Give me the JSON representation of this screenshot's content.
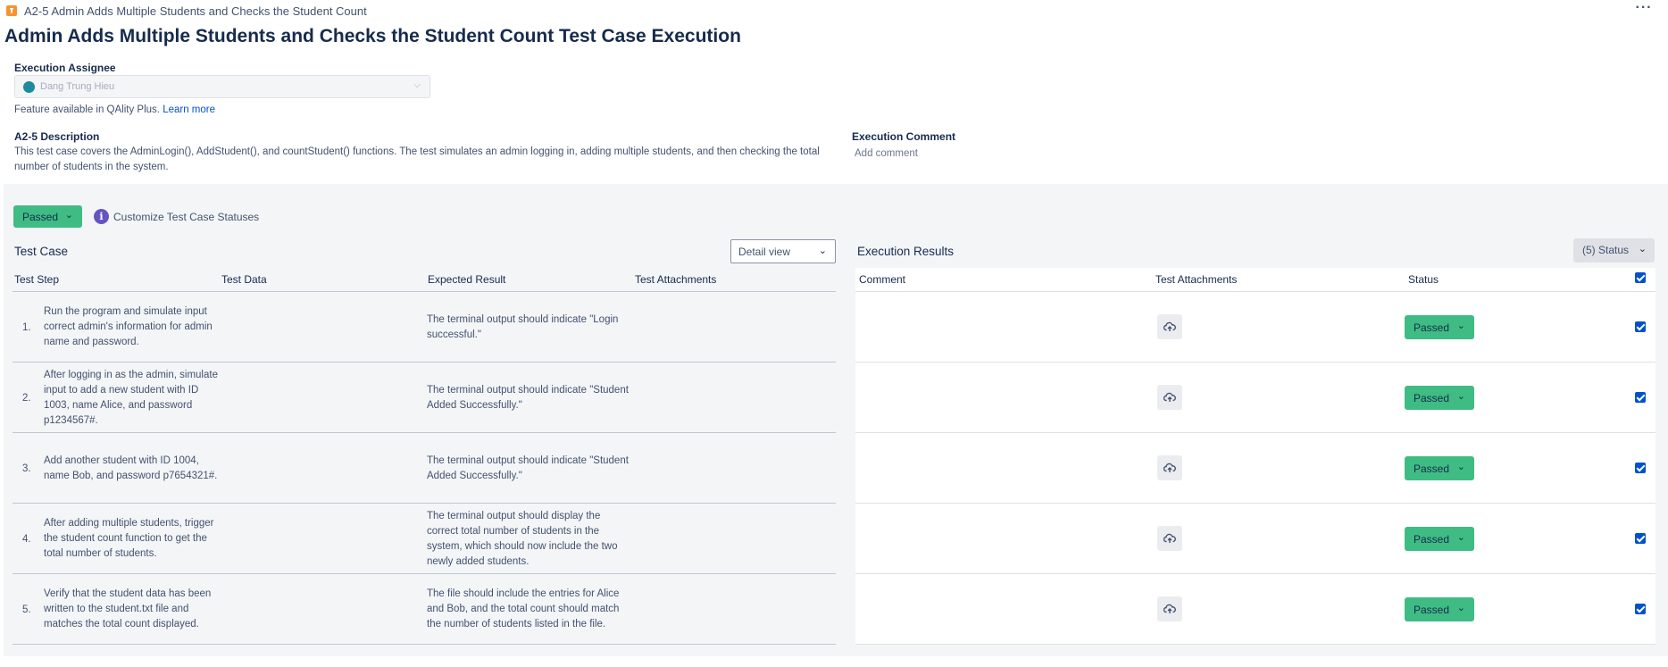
{
  "header": {
    "breadcrumb": "A2-5 Admin Adds Multiple Students and Checks the Student Count",
    "more_label": "···",
    "title": "Admin Adds Multiple Students and Checks the Student Count Test Case Execution"
  },
  "assignee": {
    "label": "Execution Assignee",
    "value": "Dang Trung Hieu",
    "feature_note": "Feature available in QAlity Plus.",
    "learn_more": "Learn more"
  },
  "description": {
    "label": "A2-5 Description",
    "text": "This test case covers the AdminLogin(), AddStudent(), and countStudent() functions. The test simulates an admin logging in, adding multiple students, and then checking the total number of students in the system."
  },
  "execution_comment": {
    "label": "Execution Comment",
    "placeholder": "Add comment"
  },
  "toolbar": {
    "overall_status": "Passed",
    "customize_label": "Customize Test Case Statuses",
    "info_glyph": "i"
  },
  "test_case": {
    "heading": "Test Case",
    "view_select": "Detail view",
    "columns": [
      "Test Step",
      "Test Data",
      "Expected Result",
      "Test Attachments"
    ],
    "rows": [
      {
        "num": "1.",
        "step": "Run the program and simulate input correct admin's information for admin name and password.",
        "data": "",
        "expected": "The terminal output should indicate \"Login successful.\""
      },
      {
        "num": "2.",
        "step": "After logging in as the admin, simulate input to add a new student with ID 1003, name Alice, and password p1234567#.",
        "data": "",
        "expected": "The terminal output should indicate \"Student Added Successfully.\""
      },
      {
        "num": "3.",
        "step": "Add another student with ID 1004, name Bob, and password p7654321#.",
        "data": "",
        "expected": "The terminal output should indicate \"Student Added Successfully.\""
      },
      {
        "num": "4.",
        "step": "After adding multiple students, trigger the student count function to get the total number of students.",
        "data": "",
        "expected": "The terminal output should display the correct total number of students in the system, which should now include the two newly added students."
      },
      {
        "num": "5.",
        "step": "Verify that the student data has been written to the student.txt file and matches the total count displayed.",
        "data": "",
        "expected": "The file should include the entries for Alice and Bob, and the total count should match the number of students listed in the file."
      }
    ]
  },
  "execution_results": {
    "heading": "Execution Results",
    "status_filter": "(5) Status",
    "columns": [
      "Comment",
      "Test Attachments",
      "Status"
    ],
    "rows": [
      {
        "comment": "",
        "status": "Passed",
        "checked": true
      },
      {
        "comment": "",
        "status": "Passed",
        "checked": true
      },
      {
        "comment": "",
        "status": "Passed",
        "checked": true
      },
      {
        "comment": "",
        "status": "Passed",
        "checked": true
      },
      {
        "comment": "",
        "status": "Passed",
        "checked": true
      }
    ]
  },
  "icons": {
    "issue": "test-case-icon",
    "attachment": "upload-cloud-icon",
    "chevron": "chevron-down-icon",
    "info": "info-icon"
  },
  "colors": {
    "passed": "#3fbc83",
    "panel_bg": "#f4f5f7",
    "link": "#0052cc",
    "info": "#6554c0",
    "checkbox": "#0052cc",
    "issue_icon": "#f79232"
  }
}
